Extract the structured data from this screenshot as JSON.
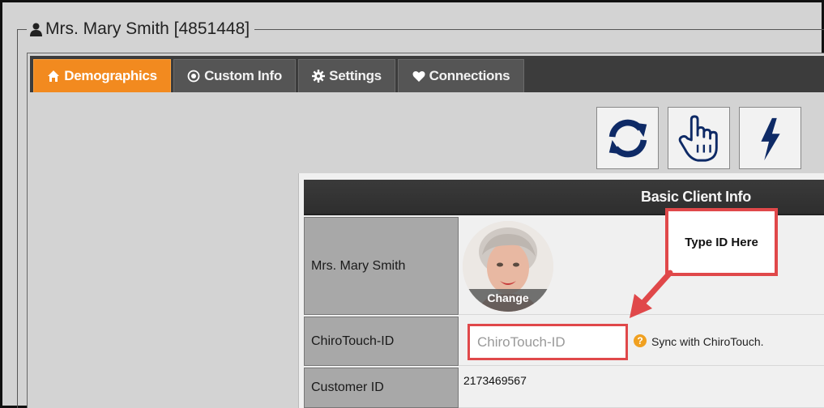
{
  "record": {
    "title": "Mrs. Mary Smith [4851448]"
  },
  "tabs": [
    {
      "label": "Demographics",
      "icon": "home-icon",
      "active": true
    },
    {
      "label": "Custom Info",
      "icon": "target-icon",
      "active": false
    },
    {
      "label": "Settings",
      "icon": "gear-icon",
      "active": false
    },
    {
      "label": "Connections",
      "icon": "heart-icon",
      "active": false
    }
  ],
  "toolbar": {
    "buttons": [
      {
        "icon": "refresh-icon"
      },
      {
        "icon": "pointer-hand-icon"
      },
      {
        "icon": "lightning-icon"
      }
    ],
    "icon_color": "#0e2a66"
  },
  "card": {
    "title": "Basic Client Info",
    "rows": [
      {
        "label": "Mrs. Mary Smith"
      },
      {
        "label": "ChiroTouch-ID"
      },
      {
        "label": "Customer ID"
      }
    ],
    "avatar": {
      "action": "Change"
    },
    "chirotouch": {
      "placeholder": "ChiroTouch-ID",
      "value": "",
      "help_text": "Sync with ChiroTouch.",
      "help_glyph": "?"
    },
    "customer_id": "2173469567"
  },
  "annotation": {
    "callout_text": "Type ID Here",
    "color": "#e0484a"
  },
  "colors": {
    "accent": "#f28a1f",
    "tabbar": "#3c3c3c"
  }
}
